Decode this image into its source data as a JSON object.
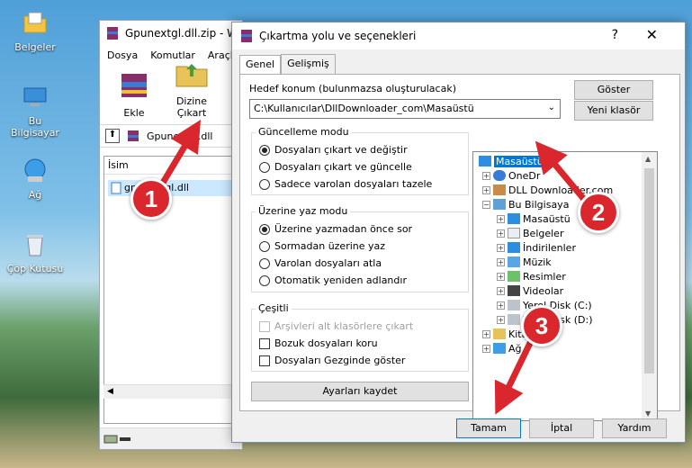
{
  "desktop": {
    "icons": [
      {
        "label": "Belgeler"
      },
      {
        "label": "Bu Bilgisayar"
      },
      {
        "label": "Ağ"
      },
      {
        "label": "Çöp Kutusu"
      }
    ]
  },
  "winrar": {
    "title": "Gpunextgl.dll.zip - W",
    "menu": [
      "Dosya",
      "Komutlar",
      "Araçla"
    ],
    "toolbar": {
      "add": "Ekle",
      "extract_to": "Dizine Çıkart"
    },
    "path": "Gpunextgl.dll",
    "list_header": "İsim",
    "file": "gpunextgl.dll"
  },
  "dialog": {
    "title": "Çıkartma yolu ve seçenekleri",
    "help": "?",
    "close": "✕",
    "tabs": [
      "Genel",
      "Gelişmiş"
    ],
    "dest_label": "Hedef konum (bulunmazsa oluşturulacak)",
    "dest_value": "C:\\Kullanıcılar\\DllDownloader_com\\Masaüstü",
    "show_button": "Göster",
    "new_folder_button": "Yeni klasör",
    "update_mode": {
      "title": "Güncelleme modu",
      "options": [
        "Dosyaları çıkart ve değiştir",
        "Dosyaları çıkart ve güncelle",
        "Sadece varolan dosyaları tazele"
      ]
    },
    "overwrite_mode": {
      "title": "Üzerine yaz modu",
      "options": [
        "Üzerine yazmadan önce sor",
        "Sormadan üzerine yaz",
        "Varolan dosyaları atla",
        "Otomatik yeniden adlandır"
      ]
    },
    "misc": {
      "title": "Çeşitli",
      "options": [
        "Arşivleri alt klasörlere çıkart",
        "Bozuk dosyaları koru",
        "Dosyaları Gezginde göster"
      ]
    },
    "save_settings": "Ayarları kaydet",
    "tree": [
      "Masaüstü",
      "OneDr",
      "DLL Downloader.com",
      "Bu Bilgisaya",
      "Masaüstü",
      "Belgeler",
      "İndirilenler",
      "Müzik",
      "Resimler",
      "Videolar",
      "Yerel Disk (C:)",
      "Yerel Disk (D:)",
      "Kitapl",
      "Ağ"
    ],
    "ok": "Tamam",
    "cancel": "İptal",
    "help_button": "Yardım"
  },
  "callouts": [
    "1",
    "2",
    "3"
  ],
  "colors": {
    "accent": "#0078d7",
    "callout": "#d9272d"
  }
}
